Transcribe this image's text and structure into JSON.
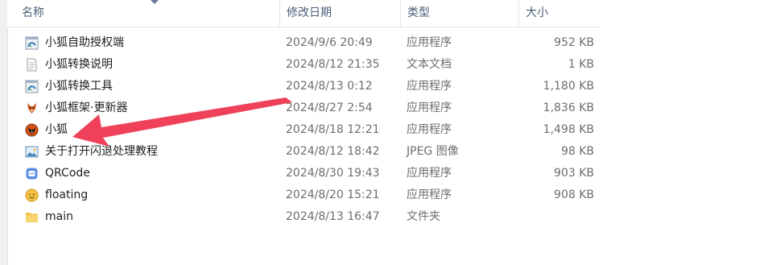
{
  "columns": {
    "name": "名称",
    "modified": "修改日期",
    "type": "类型",
    "size": "大小"
  },
  "files": [
    {
      "name": "小狐自助授权端",
      "modified": "2024/9/6 20:49",
      "type": "应用程序",
      "size": "952 KB",
      "icon": "app-exe-icon"
    },
    {
      "name": "小狐转换说明",
      "modified": "2024/8/12 21:35",
      "type": "文本文档",
      "size": "1 KB",
      "icon": "text-file-icon"
    },
    {
      "name": "小狐转换工具",
      "modified": "2024/8/13 0:12",
      "type": "应用程序",
      "size": "1,180 KB",
      "icon": "app-exe-icon"
    },
    {
      "name": "小狐框架·更新器",
      "modified": "2024/8/27 2:54",
      "type": "应用程序",
      "size": "1,836 KB",
      "icon": "fox-updater-icon"
    },
    {
      "name": "小狐",
      "modified": "2024/8/18 12:21",
      "type": "应用程序",
      "size": "1,498 KB",
      "icon": "fox-app-icon"
    },
    {
      "name": "关于打开闪退处理教程",
      "modified": "2024/8/12 18:42",
      "type": "JPEG 图像",
      "size": "98 KB",
      "icon": "image-file-icon"
    },
    {
      "name": "QRCode",
      "modified": "2024/8/30 19:43",
      "type": "应用程序",
      "size": "903 KB",
      "icon": "qrcode-app-icon"
    },
    {
      "name": "floating",
      "modified": "2024/8/20 15:21",
      "type": "应用程序",
      "size": "908 KB",
      "icon": "floating-app-icon"
    },
    {
      "name": "main",
      "modified": "2024/8/13 16:47",
      "type": "文件夹",
      "size": "",
      "icon": "folder-icon"
    }
  ],
  "colors": {
    "header_text": "#4c607a",
    "secondary_text": "#6d6d6d",
    "annotation_arrow": "#f0415a"
  }
}
